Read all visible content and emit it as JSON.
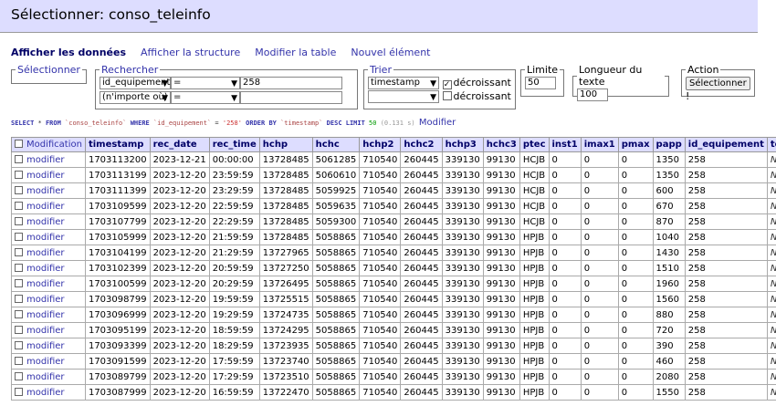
{
  "page_title": "Sélectionner: conso_teleinfo",
  "menu": [
    {
      "label": "Afficher les données",
      "active": true
    },
    {
      "label": "Afficher la structure",
      "active": false
    },
    {
      "label": "Modifier la table",
      "active": false
    },
    {
      "label": "Nouvel élément",
      "active": false
    }
  ],
  "select_box": {
    "legend": "Sélectionner"
  },
  "search_box": {
    "legend": "Rechercher",
    "row1": {
      "column": "id_equipement",
      "operator": "=",
      "value": "258"
    },
    "row2": {
      "column": "(n'importe où)",
      "operator": "=",
      "value": ""
    }
  },
  "sort_box": {
    "legend": "Trier",
    "row1": {
      "column": "timestamp",
      "checked": true,
      "label": "décroissant"
    },
    "row2": {
      "column": "",
      "checked": false,
      "label": "décroissant"
    }
  },
  "limit_box": {
    "legend": "Limite",
    "value": "50"
  },
  "text_length_box": {
    "legend": "Longueur du texte",
    "value": "100"
  },
  "action_box": {
    "legend": "Action",
    "button": "Sélectionner",
    "bang": "!"
  },
  "sql": {
    "k_select": "SELECT",
    "star": " * ",
    "k_from": "FROM",
    "table": "`conso_teleinfo`",
    "k_where": "WHERE",
    "col": "`id_equipement`",
    "eq": " = ",
    "val": "'258'",
    "k_order": "ORDER BY",
    "order_col": "`timestamp`",
    "k_desc": "DESC",
    "k_limit": "LIMIT",
    "limit": "50",
    "time": "(0.131 s)",
    "edit_link": "Modifier"
  },
  "table": {
    "select_all_label": "Modification",
    "columns": [
      "timestamp",
      "rec_date",
      "rec_time",
      "hchp",
      "hchc",
      "hchp2",
      "hchc2",
      "hchp3",
      "hchc3",
      "ptec",
      "inst1",
      "imax1",
      "pmax",
      "papp",
      "id_equipement",
      "temp"
    ],
    "edit_label": "modifier",
    "rows": [
      [
        "1703113200",
        "2023-12-21",
        "00:00:00",
        "13728485",
        "5061285",
        "710540",
        "260445",
        "339130",
        "99130",
        "HCJB",
        "0",
        "0",
        "0",
        "1350",
        "258",
        "NULL"
      ],
      [
        "1703113199",
        "2023-12-20",
        "23:59:59",
        "13728485",
        "5060610",
        "710540",
        "260445",
        "339130",
        "99130",
        "HCJB",
        "0",
        "0",
        "0",
        "1350",
        "258",
        "NULL"
      ],
      [
        "1703111399",
        "2023-12-20",
        "23:29:59",
        "13728485",
        "5059925",
        "710540",
        "260445",
        "339130",
        "99130",
        "HCJB",
        "0",
        "0",
        "0",
        "600",
        "258",
        "NULL"
      ],
      [
        "1703109599",
        "2023-12-20",
        "22:59:59",
        "13728485",
        "5059635",
        "710540",
        "260445",
        "339130",
        "99130",
        "HCJB",
        "0",
        "0",
        "0",
        "670",
        "258",
        "NULL"
      ],
      [
        "1703107799",
        "2023-12-20",
        "22:29:59",
        "13728485",
        "5059300",
        "710540",
        "260445",
        "339130",
        "99130",
        "HCJB",
        "0",
        "0",
        "0",
        "870",
        "258",
        "NULL"
      ],
      [
        "1703105999",
        "2023-12-20",
        "21:59:59",
        "13728485",
        "5058865",
        "710540",
        "260445",
        "339130",
        "99130",
        "HPJB",
        "0",
        "0",
        "0",
        "1040",
        "258",
        "NULL"
      ],
      [
        "1703104199",
        "2023-12-20",
        "21:29:59",
        "13727965",
        "5058865",
        "710540",
        "260445",
        "339130",
        "99130",
        "HPJB",
        "0",
        "0",
        "0",
        "1430",
        "258",
        "NULL"
      ],
      [
        "1703102399",
        "2023-12-20",
        "20:59:59",
        "13727250",
        "5058865",
        "710540",
        "260445",
        "339130",
        "99130",
        "HPJB",
        "0",
        "0",
        "0",
        "1510",
        "258",
        "NULL"
      ],
      [
        "1703100599",
        "2023-12-20",
        "20:29:59",
        "13726495",
        "5058865",
        "710540",
        "260445",
        "339130",
        "99130",
        "HPJB",
        "0",
        "0",
        "0",
        "1960",
        "258",
        "NULL"
      ],
      [
        "1703098799",
        "2023-12-20",
        "19:59:59",
        "13725515",
        "5058865",
        "710540",
        "260445",
        "339130",
        "99130",
        "HPJB",
        "0",
        "0",
        "0",
        "1560",
        "258",
        "NULL"
      ],
      [
        "1703096999",
        "2023-12-20",
        "19:29:59",
        "13724735",
        "5058865",
        "710540",
        "260445",
        "339130",
        "99130",
        "HPJB",
        "0",
        "0",
        "0",
        "880",
        "258",
        "NULL"
      ],
      [
        "1703095199",
        "2023-12-20",
        "18:59:59",
        "13724295",
        "5058865",
        "710540",
        "260445",
        "339130",
        "99130",
        "HPJB",
        "0",
        "0",
        "0",
        "720",
        "258",
        "NULL"
      ],
      [
        "1703093399",
        "2023-12-20",
        "18:29:59",
        "13723935",
        "5058865",
        "710540",
        "260445",
        "339130",
        "99130",
        "HPJB",
        "0",
        "0",
        "0",
        "390",
        "258",
        "NULL"
      ],
      [
        "1703091599",
        "2023-12-20",
        "17:59:59",
        "13723740",
        "5058865",
        "710540",
        "260445",
        "339130",
        "99130",
        "HPJB",
        "0",
        "0",
        "0",
        "460",
        "258",
        "NULL"
      ],
      [
        "1703089799",
        "2023-12-20",
        "17:29:59",
        "13723510",
        "5058865",
        "710540",
        "260445",
        "339130",
        "99130",
        "HPJB",
        "0",
        "0",
        "0",
        "2080",
        "258",
        "NULL"
      ],
      [
        "1703087999",
        "2023-12-20",
        "16:59:59",
        "13722470",
        "5058865",
        "710540",
        "260445",
        "339130",
        "99130",
        "HPJB",
        "0",
        "0",
        "0",
        "1550",
        "258",
        "NULL"
      ]
    ]
  }
}
